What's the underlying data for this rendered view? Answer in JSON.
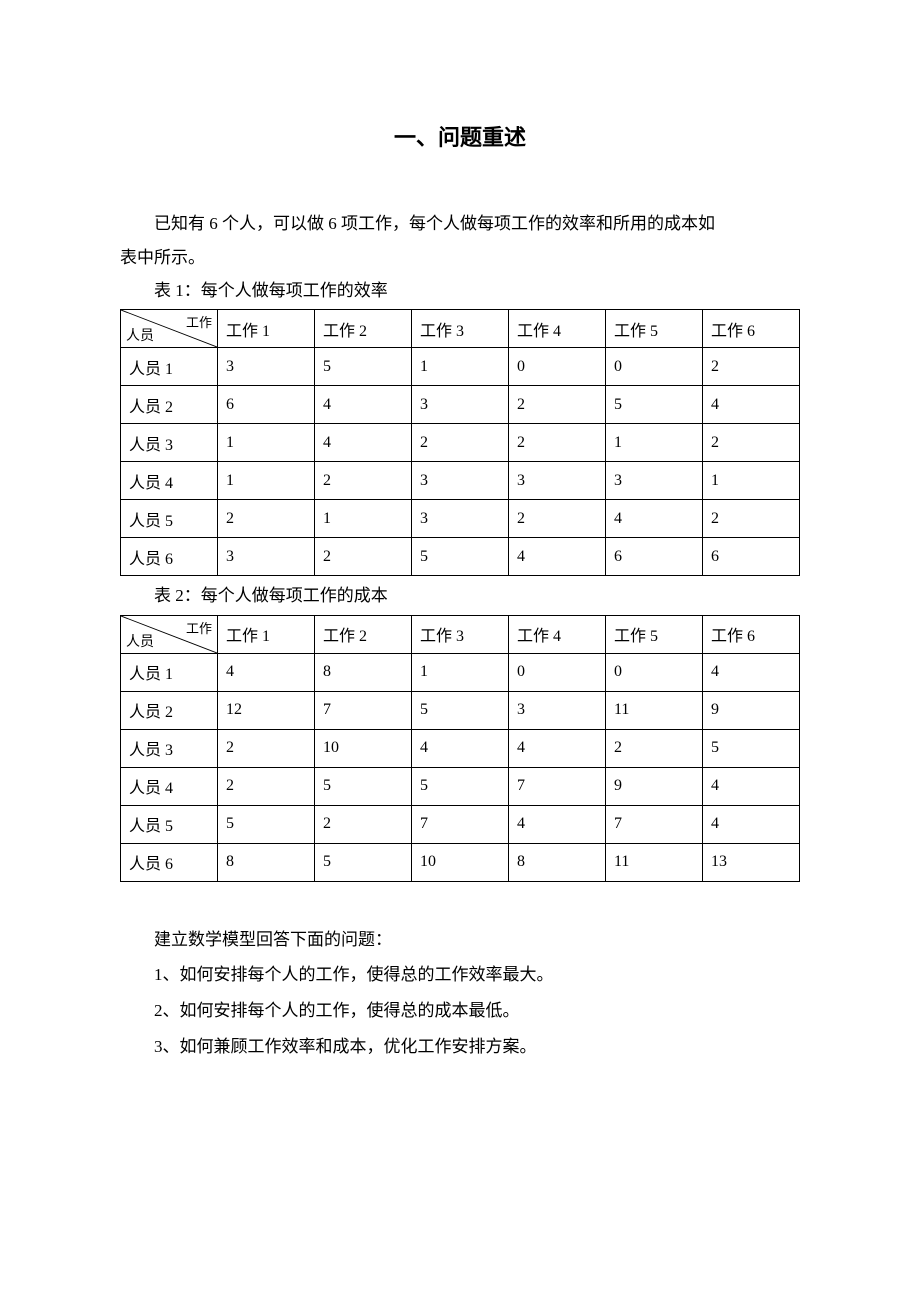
{
  "title": "一、问题重述",
  "intro_line1": "已知有 6 个人，可以做 6 项工作，每个人做每项工作的效率和所用的成本如",
  "intro_line2": "表中所示。",
  "table1_caption": "表 1：每个人做每项工作的效率",
  "table2_caption": "表 2：每个人做每项工作的成本",
  "diag_top": "工作",
  "diag_bottom": "人员",
  "col_headers": [
    "工作 1",
    "工作 2",
    "工作 3",
    "工作 4",
    "工作 5",
    "工作 6"
  ],
  "row_headers": [
    "人员 1",
    "人员 2",
    "人员 3",
    "人员 4",
    "人员 5",
    "人员 6"
  ],
  "table1": [
    [
      "3",
      "5",
      "1",
      "0",
      "0",
      "2"
    ],
    [
      "6",
      "4",
      "3",
      "2",
      "5",
      "4"
    ],
    [
      "1",
      "4",
      "2",
      "2",
      "1",
      "2"
    ],
    [
      "1",
      "2",
      "3",
      "3",
      "3",
      "1"
    ],
    [
      "2",
      "1",
      "3",
      "2",
      "4",
      "2"
    ],
    [
      "3",
      "2",
      "5",
      "4",
      "6",
      "6"
    ]
  ],
  "table2": [
    [
      "4",
      "8",
      "1",
      "0",
      "0",
      "4"
    ],
    [
      "12",
      "7",
      "5",
      "3",
      "11",
      "9"
    ],
    [
      "2",
      "10",
      "4",
      "4",
      "2",
      "5"
    ],
    [
      "2",
      "5",
      "5",
      "7",
      "9",
      "4"
    ],
    [
      "5",
      "2",
      "7",
      "4",
      "7",
      "4"
    ],
    [
      "8",
      "5",
      "10",
      "8",
      "11",
      "13"
    ]
  ],
  "questions_intro": "建立数学模型回答下面的问题：",
  "q1": "1、如何安排每个人的工作，使得总的工作效率最大。",
  "q2": "2、如何安排每个人的工作，使得总的成本最低。",
  "q3": "3、如何兼顾工作效率和成本，优化工作安排方案。",
  "chart_data": [
    {
      "type": "table",
      "title": "表 1：每个人做每项工作的效率",
      "columns": [
        "工作 1",
        "工作 2",
        "工作 3",
        "工作 4",
        "工作 5",
        "工作 6"
      ],
      "rows": [
        "人员 1",
        "人员 2",
        "人员 3",
        "人员 4",
        "人员 5",
        "人员 6"
      ],
      "values": [
        [
          3,
          5,
          1,
          0,
          0,
          2
        ],
        [
          6,
          4,
          3,
          2,
          5,
          4
        ],
        [
          1,
          4,
          2,
          2,
          1,
          2
        ],
        [
          1,
          2,
          3,
          3,
          3,
          1
        ],
        [
          2,
          1,
          3,
          2,
          4,
          2
        ],
        [
          3,
          2,
          5,
          4,
          6,
          6
        ]
      ]
    },
    {
      "type": "table",
      "title": "表 2：每个人做每项工作的成本",
      "columns": [
        "工作 1",
        "工作 2",
        "工作 3",
        "工作 4",
        "工作 5",
        "工作 6"
      ],
      "rows": [
        "人员 1",
        "人员 2",
        "人员 3",
        "人员 4",
        "人员 5",
        "人员 6"
      ],
      "values": [
        [
          4,
          8,
          1,
          0,
          0,
          4
        ],
        [
          12,
          7,
          5,
          3,
          11,
          9
        ],
        [
          2,
          10,
          4,
          4,
          2,
          5
        ],
        [
          2,
          5,
          5,
          7,
          9,
          4
        ],
        [
          5,
          2,
          7,
          4,
          7,
          4
        ],
        [
          8,
          5,
          10,
          8,
          11,
          13
        ]
      ]
    }
  ]
}
